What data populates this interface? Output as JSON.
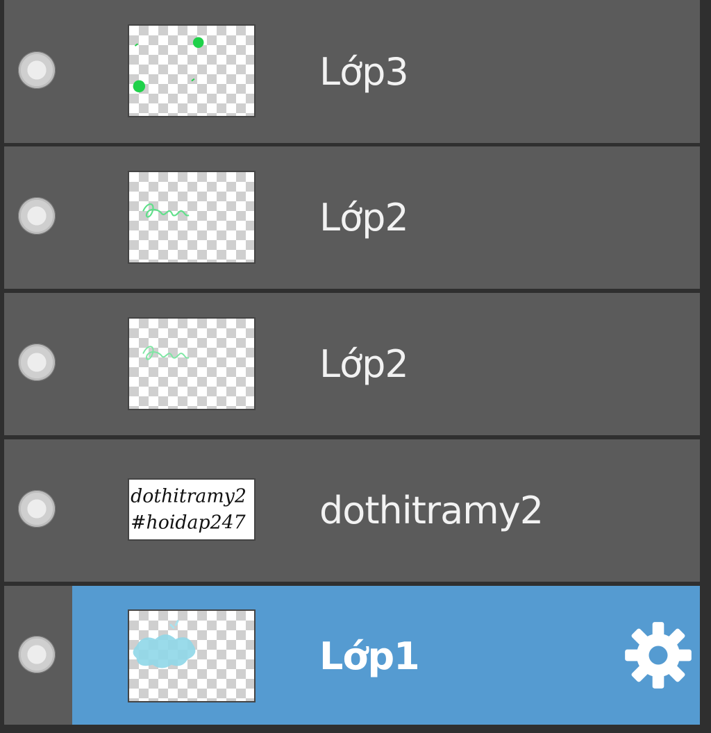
{
  "layers_panel": {
    "layers": [
      {
        "name": "Lớp3",
        "thumbnail": "green-dots-on-transparent",
        "selected": false
      },
      {
        "name": "Lớp2",
        "thumbnail": "green-script-on-transparent",
        "selected": false
      },
      {
        "name": "Lớp2",
        "thumbnail": "green-script-on-transparent",
        "selected": false
      },
      {
        "name": "dothitramy2",
        "thumbnail": "text-preview",
        "thumbnail_text": [
          "dothitramy2",
          "#hoidap247"
        ],
        "selected": false
      },
      {
        "name": "Lớp1",
        "thumbnail": "cyan-blob-on-transparent",
        "selected": true
      }
    ],
    "settings_icon": "gear-icon",
    "visibility_icon": "visibility-dot-icon",
    "colors": {
      "row_bg": "#5b5b5b",
      "selected_bg": "#559bd1",
      "separator": "#2f2f2f",
      "text": "#f2f2f2"
    }
  }
}
